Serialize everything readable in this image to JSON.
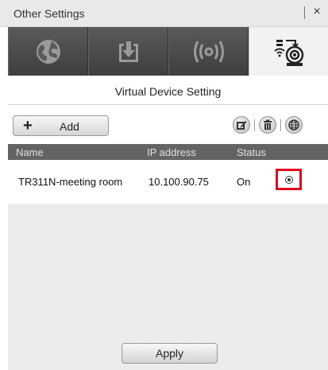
{
  "window": {
    "title": "Other Settings",
    "close_glyph": "×"
  },
  "tabs": [
    {
      "name": "globe-icon",
      "active": false
    },
    {
      "name": "download-icon",
      "active": false
    },
    {
      "name": "broadcast-icon",
      "active": false
    },
    {
      "name": "virtual-device-icon",
      "active": true
    }
  ],
  "section": {
    "title": "Virtual Device Setting"
  },
  "toolbar": {
    "add_label": "Add",
    "add_glyph": "+",
    "icons": [
      "edit-icon",
      "delete-icon",
      "network-globe-icon"
    ]
  },
  "table": {
    "columns": [
      "Name",
      "IP address",
      "Status"
    ],
    "rows": [
      {
        "name": "TR311N-meeting room",
        "ip": "10.100.90.75",
        "status": "On"
      }
    ]
  },
  "footer": {
    "apply_label": "Apply"
  },
  "colors": {
    "highlight": "#e3001b",
    "tab_bar": "#4a4a4a",
    "header": "#636363"
  }
}
